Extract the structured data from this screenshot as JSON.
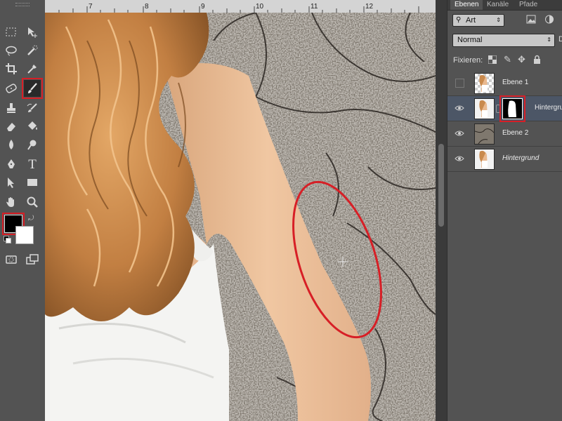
{
  "ruler": {
    "ticks": [
      "7",
      "8",
      "9",
      "10",
      "11",
      "12"
    ]
  },
  "panel": {
    "tabs": [
      "Ebenen",
      "Kanäle",
      "Pfade"
    ],
    "filter_label": "Art",
    "blend_mode": "Normal",
    "opacity_label_partial": "D",
    "lock_label": "Fixieren:",
    "layers": [
      {
        "name": "Ebene 1",
        "visible": false,
        "italic": false
      },
      {
        "name": "Hintergrund",
        "visible": true,
        "italic": false,
        "has_mask": true,
        "selected": true
      },
      {
        "name": "Ebene 2",
        "visible": true,
        "italic": false
      },
      {
        "name": "Hintergrund",
        "visible": true,
        "italic": true
      }
    ]
  },
  "toolbar": {
    "tools": [
      "marquee-tool",
      "move-tool",
      "lasso-tool",
      "quick-selection-tool",
      "crop-tool",
      "eyedropper-tool",
      "healing-tool",
      "brush-tool",
      "clone-stamp-tool",
      "history-brush-tool",
      "eraser-tool",
      "paint-bucket-tool",
      "blur-tool",
      "dodge-tool",
      "pen-tool",
      "type-tool",
      "path-selection-tool",
      "rectangle-tool",
      "hand-tool",
      "zoom-tool",
      "quick-mask-tool",
      "screen-mode-tool"
    ],
    "active_tool": "brush-tool",
    "text_tool_glyph": "T"
  },
  "colors": {
    "foreground": "#000000",
    "background": "#ffffff",
    "highlight": "#d71f26"
  }
}
